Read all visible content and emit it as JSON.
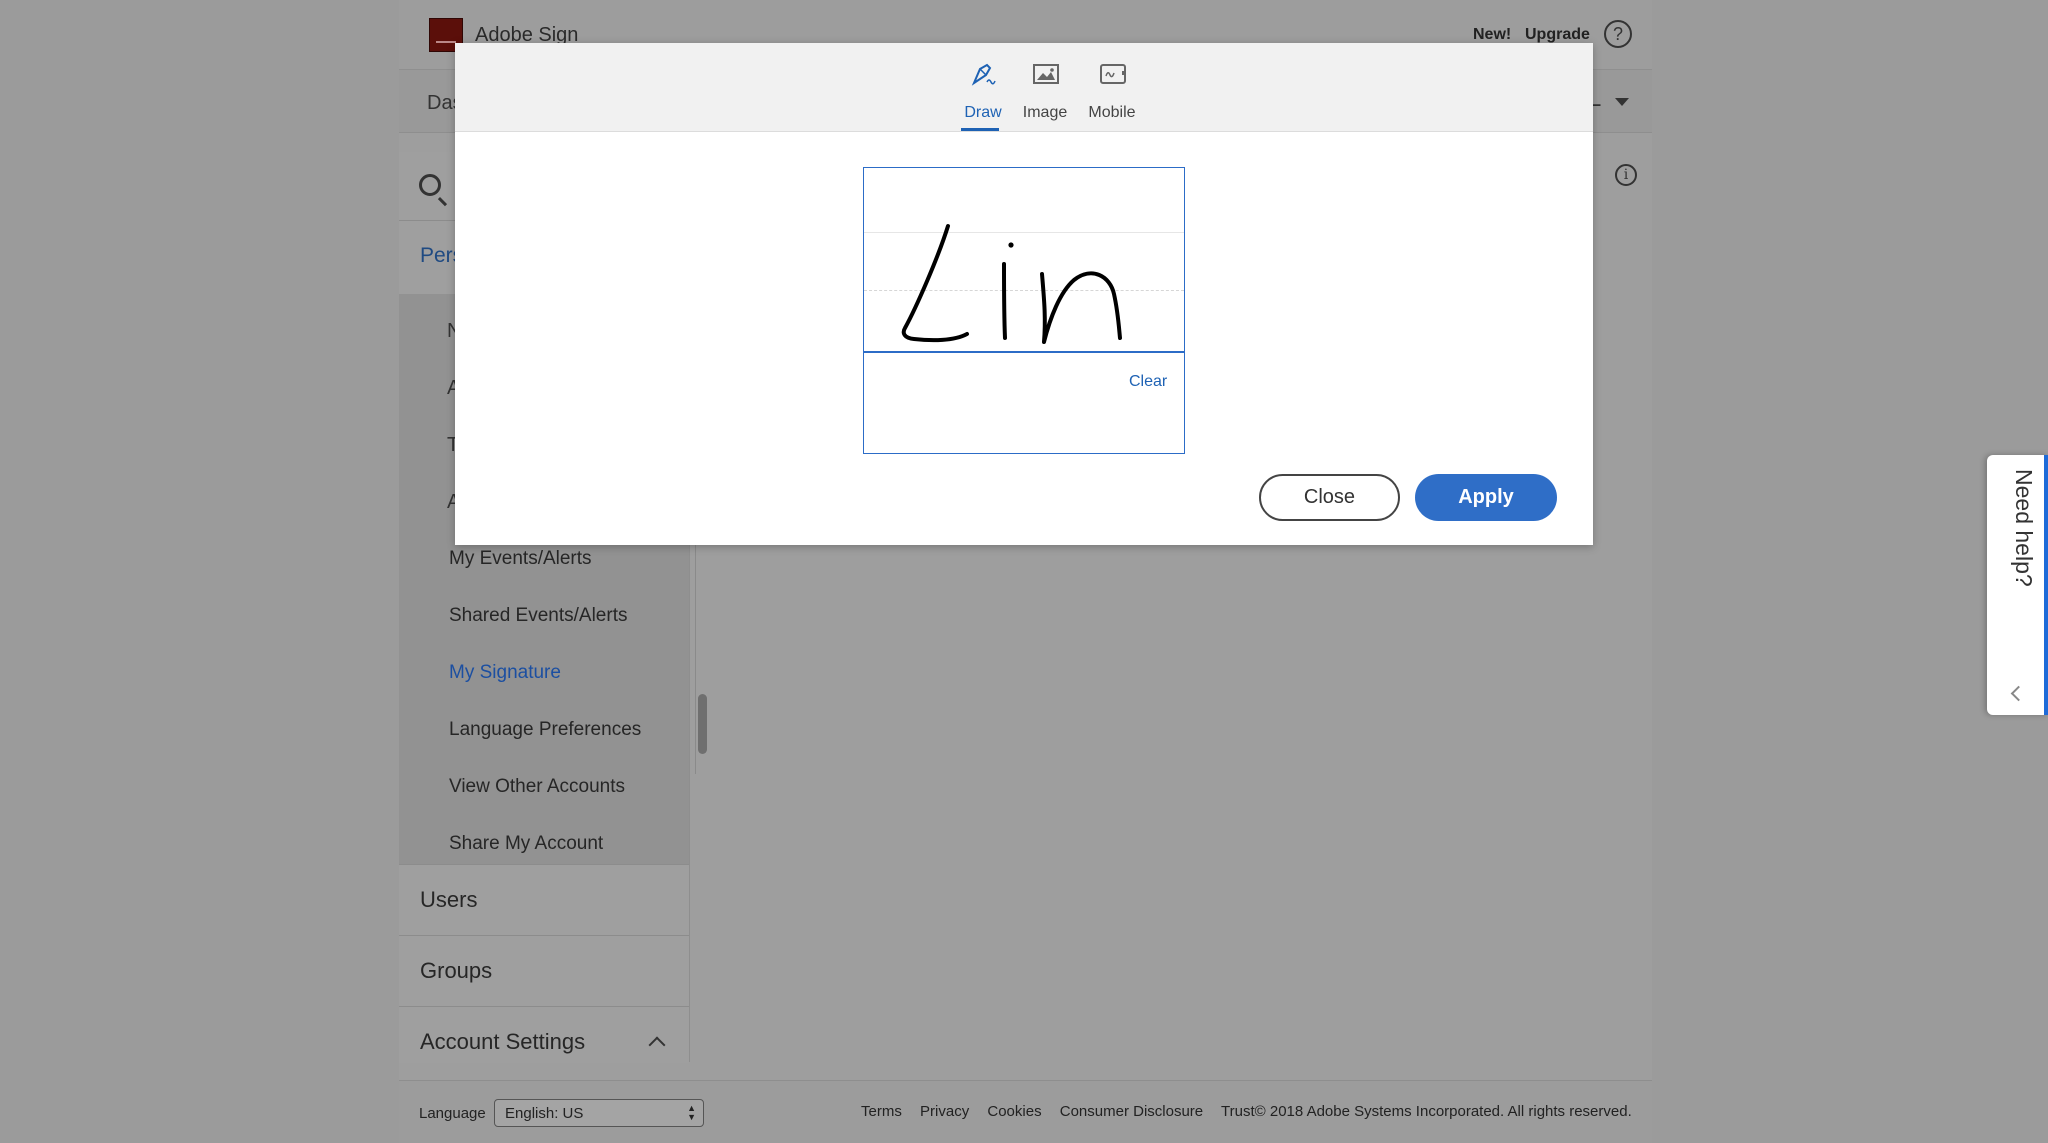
{
  "header": {
    "brand": "Adobe Sign",
    "new_label": "New!",
    "upgrade_label": "Upgrade",
    "help_symbol": "?"
  },
  "navbar": {
    "first_tab_partial": "Das",
    "user_partial": "L"
  },
  "sidebar": {
    "section_partial": "Pers",
    "truncated_items": [
      "N",
      "A",
      "T",
      "A"
    ],
    "items": [
      {
        "label": "My Events/Alerts",
        "active": false
      },
      {
        "label": "Shared Events/Alerts",
        "active": false
      },
      {
        "label": "My Signature",
        "active": true
      },
      {
        "label": "Language Preferences",
        "active": false
      },
      {
        "label": "View Other Accounts",
        "active": false
      },
      {
        "label": "Share My Account",
        "active": false
      }
    ],
    "sections": [
      {
        "label": "Users"
      },
      {
        "label": "Groups"
      },
      {
        "label": "Account Settings",
        "expanded": true
      }
    ]
  },
  "info_symbol": "i",
  "footer": {
    "language_label": "Language",
    "language_value": "English: US",
    "links": [
      "Terms",
      "Privacy",
      "Cookies",
      "Consumer Disclosure"
    ],
    "copyright": "Trust© 2018 Adobe Systems Incorporated. All rights reserved."
  },
  "need_help": {
    "label": "Need help?"
  },
  "modal": {
    "tabs": [
      {
        "label": "Draw",
        "icon": "pen-icon",
        "active": true
      },
      {
        "label": "Image",
        "icon": "image-icon",
        "active": false
      },
      {
        "label": "Mobile",
        "icon": "mobile-icon",
        "active": false
      }
    ],
    "clear_label": "Clear",
    "close_label": "Close",
    "apply_label": "Apply"
  },
  "colors": {
    "accent": "#2f6ec7",
    "active_link": "#1c4fa1",
    "overlay": "#9b9b9b"
  }
}
